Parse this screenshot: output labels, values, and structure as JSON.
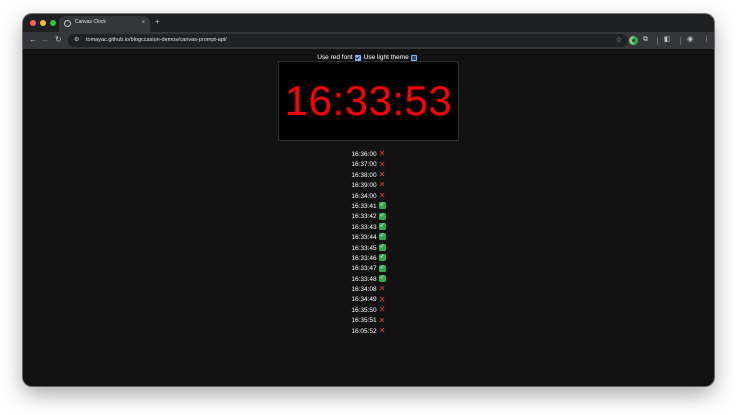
{
  "browser": {
    "tab_title": "Canvas Clock",
    "tab_close_icon": "×",
    "new_tab_icon": "+",
    "nav_back_icon": "←",
    "nav_forward_icon": "→",
    "nav_reload_icon": "↻",
    "url": "tomayac.github.io/blogccasion-demos/canvas-prompt-api/",
    "bookmark_icon": "☆",
    "menu_icon": "⋮"
  },
  "controls": {
    "red_font_label": "Use red font",
    "red_font_checked": true,
    "light_theme_label": "Use light theme",
    "light_theme_checked": false
  },
  "clock": {
    "time": "16:33:53",
    "color": "#ff0000",
    "background": "#000000"
  },
  "predictions": [
    {
      "time": "16:36:00",
      "correct": false
    },
    {
      "time": "16:37:00",
      "correct": false
    },
    {
      "time": "16:38:00",
      "correct": false
    },
    {
      "time": "16:39:00",
      "correct": false
    },
    {
      "time": "16:34:00",
      "correct": false
    },
    {
      "time": "16:33:41",
      "correct": true
    },
    {
      "time": "16:33:42",
      "correct": true
    },
    {
      "time": "16:33:43",
      "correct": true
    },
    {
      "time": "16:33:44",
      "correct": true
    },
    {
      "time": "16:33:45",
      "correct": true
    },
    {
      "time": "16:33:46",
      "correct": true
    },
    {
      "time": "16:33:47",
      "correct": true
    },
    {
      "time": "16:33:48",
      "correct": true
    },
    {
      "time": "16:34:08",
      "correct": false
    },
    {
      "time": "16:34:49",
      "correct": false
    },
    {
      "time": "16:35:50",
      "correct": false
    },
    {
      "time": "16:35:51",
      "correct": false
    },
    {
      "time": "16:05:52",
      "correct": false
    }
  ],
  "marks": {
    "correct_icon": "✓",
    "wrong_icon": "✕"
  },
  "colors": {
    "correct": "#2fa84f",
    "wrong": "#e8353b",
    "page_background": "#121212"
  }
}
